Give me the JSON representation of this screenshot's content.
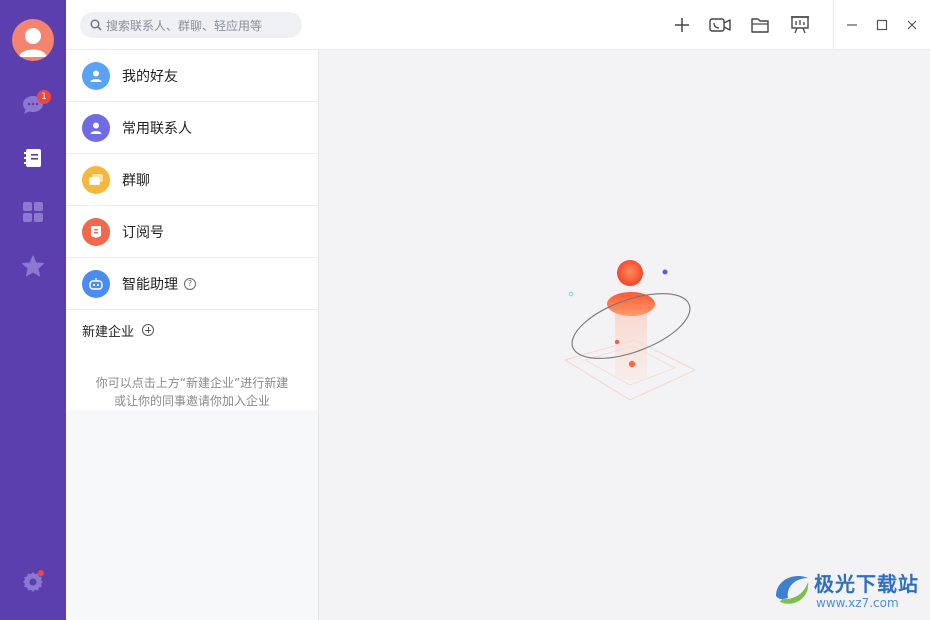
{
  "search": {
    "placeholder": "搜索联系人、群聊、轻应用等"
  },
  "sidebar": {
    "unread_badge": "1"
  },
  "contacts": {
    "items": [
      {
        "label": "我的好友",
        "icon": "person-icon",
        "color": "#5aa2f3"
      },
      {
        "label": "常用联系人",
        "icon": "person-icon",
        "color": "#6f6be5"
      },
      {
        "label": "群聊",
        "icon": "chat-bubbles-icon",
        "color": "#f6b73c"
      },
      {
        "label": "订阅号",
        "icon": "bookmark-icon",
        "color": "#f3674b"
      },
      {
        "label": "智能助理",
        "icon": "robot-icon",
        "color": "#4b8cf3"
      }
    ],
    "new_enterprise": "新建企业",
    "hint_line1": "你可以点击上方“新建企业”进行新建",
    "hint_line2": "或让你的同事邀请你加入企业"
  },
  "watermark": {
    "title": "极光下载站",
    "url": "www.xz7.com"
  },
  "colors": {
    "rail": "#5b3fae",
    "accent": "#f3674b"
  }
}
